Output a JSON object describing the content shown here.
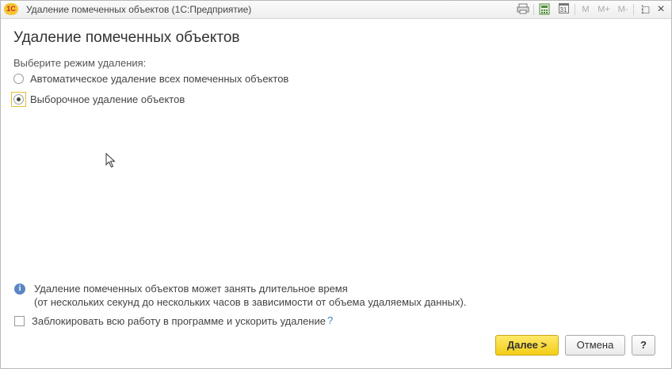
{
  "window": {
    "logo": "1С",
    "title": "Удаление помеченных объектов  (1С:Предприятие)",
    "toolbar_icons": [
      "printer-icon",
      "calculator-icon",
      "calendar-icon",
      "memory-m-icon",
      "memory-mplus-icon",
      "memory-mminus-icon",
      "more-icon",
      "maximize-icon",
      "close-icon"
    ],
    "toolbar_labels": {
      "calendar": "31",
      "m": "M",
      "mplus": "M+",
      "mminus": "M-",
      "more": "⋮",
      "maximize": "□",
      "close": "×"
    }
  },
  "main": {
    "heading": "Удаление помеченных объектов",
    "mode_label": "Выберите режим удаления:",
    "modes": [
      {
        "label": "Автоматическое удаление всех помеченных объектов",
        "selected": false
      },
      {
        "label": "Выборочное удаление объектов",
        "selected": true
      }
    ],
    "info_line1": "Удаление помеченных объектов может занять длительное время",
    "info_line2": "(от нескольких секунд до нескольких часов в зависимости от объема удаляемых данных).",
    "lock_checkbox_label": "Заблокировать всю работу в программе и ускорить удаление",
    "lock_checkbox_checked": false,
    "help_mark": "?"
  },
  "buttons": {
    "next": "Далее >",
    "cancel": "Отмена",
    "help": "?"
  },
  "colors": {
    "accent": "#f2cd17",
    "info": "#5b86c4",
    "link": "#3b7fc4"
  }
}
